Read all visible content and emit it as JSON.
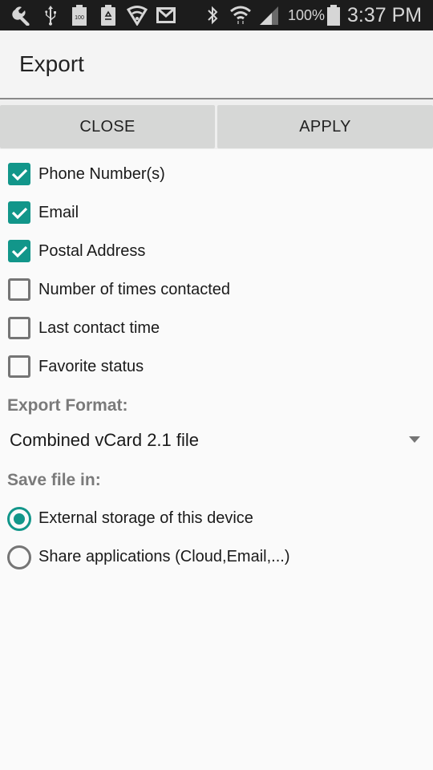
{
  "status_bar": {
    "left_icons": [
      "wrench-icon",
      "usb-icon",
      "battery-100-notification-icon",
      "recycle-icon",
      "shield-wifi-icon",
      "gmail-icon"
    ],
    "right_icons": [
      "bluetooth-icon",
      "wifi-icon",
      "signal-icon"
    ],
    "battery_percent": "100%",
    "time": "3:37 PM",
    "battery_badge": "100"
  },
  "app_bar": {
    "title": "Export"
  },
  "buttons": {
    "close_label": "CLOSE",
    "apply_label": "APPLY"
  },
  "fields": [
    {
      "label": "Phone Number(s)",
      "checked": true
    },
    {
      "label": "Email",
      "checked": true
    },
    {
      "label": "Postal Address",
      "checked": true
    },
    {
      "label": "Number of times contacted",
      "checked": false
    },
    {
      "label": "Last contact time",
      "checked": false
    },
    {
      "label": "Favorite status",
      "checked": false
    }
  ],
  "export_format": {
    "label": "Export Format:",
    "selected": "Combined vCard 2.1 file"
  },
  "save_location": {
    "label": "Save file in:",
    "options": [
      {
        "label": "External storage of this device",
        "selected": true
      },
      {
        "label": "Share applications (Cloud,Email,...)",
        "selected": false
      }
    ]
  },
  "colors": {
    "accent": "#12968a",
    "status_bar": "#1c1c1c",
    "button_bg": "#d6d7d6",
    "section_label": "#7a7a7a"
  }
}
